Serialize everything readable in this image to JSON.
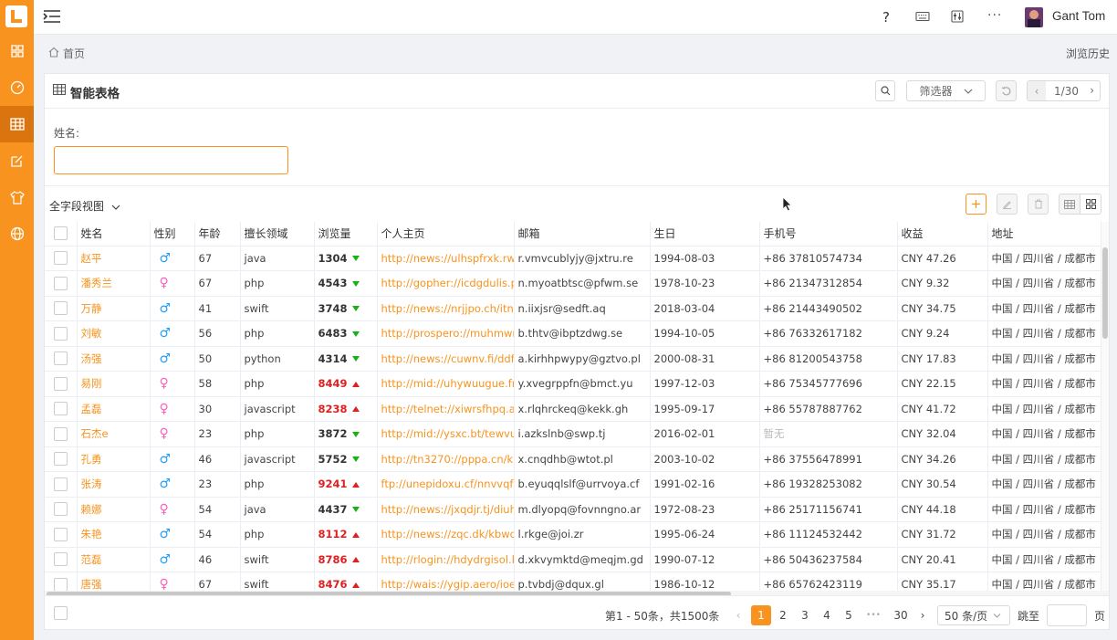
{
  "user": {
    "name": "Gant Tom"
  },
  "breadcrumb": {
    "home": "首页",
    "history": "浏览历史"
  },
  "panel": {
    "title": "智能表格",
    "filter_label": "筛选器",
    "page_indicator": "1/30"
  },
  "search": {
    "label": "姓名:",
    "value": ""
  },
  "view": {
    "label": "全字段视图"
  },
  "columns": [
    "姓名",
    "性别",
    "年龄",
    "擅长领域",
    "浏览量",
    "个人主页",
    "邮箱",
    "生日",
    "手机号",
    "收益",
    "地址"
  ],
  "rows": [
    {
      "name": "赵平",
      "gender": "male",
      "age": "67",
      "field": "java",
      "views": "1304",
      "trend": "down",
      "url": "http://news://ulhspfrxk.rw",
      "email": "r.vmvcublyjy@jxtru.re",
      "birthday": "1994-08-03",
      "phone": "+86 37810574734",
      "income": "CNY 47.26",
      "address": "中国 / 四川省 / 成都市"
    },
    {
      "name": "潘秀兰",
      "gender": "female",
      "age": "67",
      "field": "php",
      "views": "4543",
      "trend": "down",
      "url": "http://gopher://icdgdulis.p",
      "email": "n.myoatbtsc@pfwm.se",
      "birthday": "1978-10-23",
      "phone": "+86 21347312854",
      "income": "CNY 9.32",
      "address": "中国 / 四川省 / 成都市"
    },
    {
      "name": "万静",
      "gender": "male",
      "age": "41",
      "field": "swift",
      "views": "3748",
      "trend": "down",
      "url": "http://news://nrjjpo.ch/itnt",
      "email": "n.iixjsr@sedft.aq",
      "birthday": "2018-03-04",
      "phone": "+86 21443490502",
      "income": "CNY 34.75",
      "address": "中国 / 四川省 / 成都市"
    },
    {
      "name": "刘敏",
      "gender": "male",
      "age": "56",
      "field": "php",
      "views": "6483",
      "trend": "down",
      "url": "http://prospero://muhmwr",
      "email": "b.thtv@ibptzdwg.se",
      "birthday": "1994-10-05",
      "phone": "+86 76332617182",
      "income": "CNY 9.24",
      "address": "中国 / 四川省 / 成都市"
    },
    {
      "name": "汤强",
      "gender": "male",
      "age": "50",
      "field": "python",
      "views": "4314",
      "trend": "down",
      "url": "http://news://cuwnv.fi/ddf",
      "email": "a.kirhhpwypy@gztvo.pl",
      "birthday": "2000-08-31",
      "phone": "+86 81200543758",
      "income": "CNY 17.83",
      "address": "中国 / 四川省 / 成都市"
    },
    {
      "name": "易刚",
      "gender": "female",
      "age": "58",
      "field": "php",
      "views": "8449",
      "trend": "up",
      "url": "http://mid://uhywuugue.fr",
      "email": "y.xvegrppfn@bmct.yu",
      "birthday": "1997-12-03",
      "phone": "+86 75345777696",
      "income": "CNY 22.15",
      "address": "中国 / 四川省 / 成都市"
    },
    {
      "name": "孟磊",
      "gender": "female",
      "age": "30",
      "field": "javascript",
      "views": "8238",
      "trend": "up",
      "url": "http://telnet://xiwrsfhpq.a",
      "email": "x.rlqhrckeq@kekk.gh",
      "birthday": "1995-09-17",
      "phone": "+86 55787887762",
      "income": "CNY 41.72",
      "address": "中国 / 四川省 / 成都市"
    },
    {
      "name": "石杰e",
      "gender": "female",
      "age": "23",
      "field": "php",
      "views": "3872",
      "trend": "down",
      "url": "http://mid://ysxc.bt/tewvu",
      "email": "i.azkslnb@swp.tj",
      "birthday": "2016-02-01",
      "phone": "暂无",
      "income": "CNY 32.04",
      "address": "中国 / 四川省 / 成都市"
    },
    {
      "name": "孔勇",
      "gender": "male",
      "age": "46",
      "field": "javascript",
      "views": "5752",
      "trend": "down",
      "url": "http://tn3270://pppa.cn/k",
      "email": "x.cnqdhb@wtot.pl",
      "birthday": "2003-10-02",
      "phone": "+86 37556478991",
      "income": "CNY 34.26",
      "address": "中国 / 四川省 / 成都市"
    },
    {
      "name": "张涛",
      "gender": "male",
      "age": "23",
      "field": "php",
      "views": "9241",
      "trend": "up",
      "url": "ftp://unepidoxu.cf/nnvvqf",
      "email": "b.eyuqqlslf@urrvoya.cf",
      "birthday": "1991-02-16",
      "phone": "+86 19328253082",
      "income": "CNY 30.54",
      "address": "中国 / 四川省 / 成都市"
    },
    {
      "name": "赖娜",
      "gender": "female",
      "age": "54",
      "field": "java",
      "views": "4437",
      "trend": "down",
      "url": "http://news://jxqdjr.tj/diuh",
      "email": "m.dlyopq@fovnngno.ar",
      "birthday": "1972-08-23",
      "phone": "+86 25171156741",
      "income": "CNY 44.18",
      "address": "中国 / 四川省 / 成都市"
    },
    {
      "name": "朱艳",
      "gender": "male",
      "age": "54",
      "field": "php",
      "views": "8112",
      "trend": "up",
      "url": "http://news://zqc.dk/kbwc",
      "email": "l.rkge@joi.zr",
      "birthday": "1995-06-24",
      "phone": "+86 11124532442",
      "income": "CNY 31.72",
      "address": "中国 / 四川省 / 成都市"
    },
    {
      "name": "范磊",
      "gender": "male",
      "age": "46",
      "field": "swift",
      "views": "8786",
      "trend": "up",
      "url": "http://rlogin://hdydrgisol.b",
      "email": "d.xkvymktd@meqjm.gd",
      "birthday": "1990-07-12",
      "phone": "+86 50436237584",
      "income": "CNY 20.41",
      "address": "中国 / 四川省 / 成都市"
    },
    {
      "name": "唐强",
      "gender": "female",
      "age": "67",
      "field": "swift",
      "views": "8476",
      "trend": "up",
      "url": "http://wais://ygip.aero/ioe",
      "email": "p.tvbdj@dqux.gl",
      "birthday": "1986-10-12",
      "phone": "+86 65762423119",
      "income": "CNY 35.17",
      "address": "中国 / 四川省 / 成都市"
    }
  ],
  "pagination": {
    "summary": "第1 - 50条，共1500条",
    "pages": [
      "1",
      "2",
      "3",
      "4",
      "5"
    ],
    "ellipsis": "•••",
    "last": "30",
    "page_size": "50 条/页",
    "jump_label": "跳至",
    "page_suffix": "页"
  },
  "colors": {
    "accent": "#f7931e",
    "up": "#e02020",
    "down": "#16b216",
    "male": "#1e9fff",
    "female": "#ff5fbd"
  }
}
